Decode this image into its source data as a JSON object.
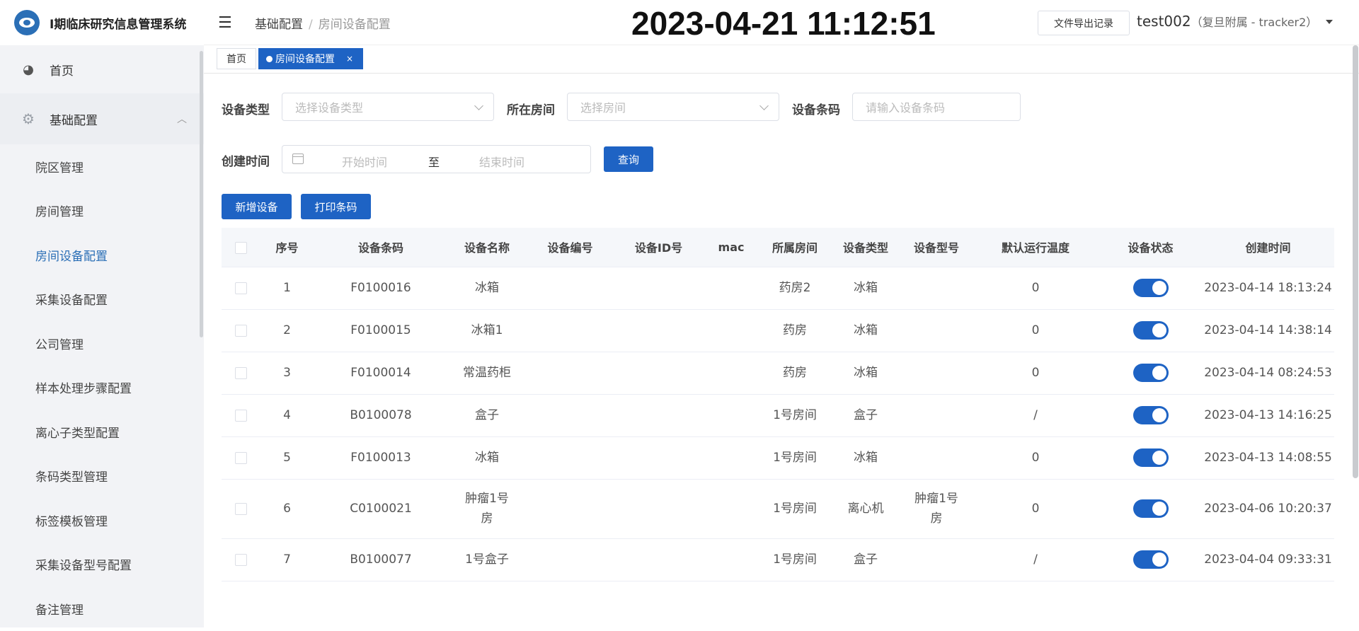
{
  "app": {
    "title": "I期临床研究信息管理系统"
  },
  "sidebar": {
    "home_label": "首页",
    "group_label": "基础配置",
    "items": [
      {
        "label": "院区管理"
      },
      {
        "label": "房间管理"
      },
      {
        "label": "房间设备配置",
        "active": true
      },
      {
        "label": "采集设备配置"
      },
      {
        "label": "公司管理"
      },
      {
        "label": "样本处理步骤配置"
      },
      {
        "label": "离心子类型配置"
      },
      {
        "label": "条码类型管理"
      },
      {
        "label": "标签模板管理"
      },
      {
        "label": "采集设备型号配置"
      },
      {
        "label": "备注管理"
      }
    ]
  },
  "header": {
    "breadcrumb": [
      "基础配置",
      "房间设备配置"
    ],
    "breadcrumb_sep": "/",
    "clock": "2023-04-21 11:12:51",
    "export_label": "文件导出记录",
    "user_name": "test002",
    "user_org": "（复旦附属 - tracker2）"
  },
  "tabs": {
    "home": "首页",
    "current": "房间设备配置",
    "close": "×"
  },
  "filters": {
    "device_type_label": "设备类型",
    "device_type_placeholder": "选择设备类型",
    "room_label": "所在房间",
    "room_placeholder": "选择房间",
    "barcode_label": "设备条码",
    "barcode_placeholder": "请输入设备条码",
    "created_label": "创建时间",
    "start_placeholder": "开始时间",
    "range_sep": "至",
    "end_placeholder": "结束时间",
    "query_label": "查询"
  },
  "actions": {
    "add_label": "新增设备",
    "print_label": "打印条码"
  },
  "table": {
    "columns": [
      "序号",
      "设备条码",
      "设备名称",
      "设备编号",
      "设备ID号",
      "mac",
      "所属房间",
      "设备类型",
      "设备型号",
      "默认运行温度",
      "设备状态",
      "创建时间"
    ],
    "rows": [
      {
        "no": "1",
        "barcode": "F0100016",
        "name": "冰箱",
        "code": "",
        "devid": "",
        "mac": "",
        "room": "药房2",
        "type": "冰箱",
        "model": "",
        "temp": "0",
        "status_on": true,
        "created": "2023-04-14 18:13:24"
      },
      {
        "no": "2",
        "barcode": "F0100015",
        "name": "冰箱1",
        "code": "",
        "devid": "",
        "mac": "",
        "room": "药房",
        "type": "冰箱",
        "model": "",
        "temp": "0",
        "status_on": true,
        "created": "2023-04-14 14:38:14"
      },
      {
        "no": "3",
        "barcode": "F0100014",
        "name": "常温药柜",
        "code": "",
        "devid": "",
        "mac": "",
        "room": "药房",
        "type": "冰箱",
        "model": "",
        "temp": "0",
        "status_on": true,
        "created": "2023-04-14 08:24:53"
      },
      {
        "no": "4",
        "barcode": "B0100078",
        "name": "盒子",
        "code": "",
        "devid": "",
        "mac": "",
        "room": "1号房间",
        "type": "盒子",
        "model": "",
        "temp": "/",
        "status_on": true,
        "created": "2023-04-13 14:16:25"
      },
      {
        "no": "5",
        "barcode": "F0100013",
        "name": "冰箱",
        "code": "",
        "devid": "",
        "mac": "",
        "room": "1号房间",
        "type": "冰箱",
        "model": "",
        "temp": "0",
        "status_on": true,
        "created": "2023-04-13 14:08:55"
      },
      {
        "no": "6",
        "barcode": "C0100021",
        "name": "肿瘤1号房",
        "code": "",
        "devid": "",
        "mac": "",
        "room": "1号房间",
        "type": "离心机",
        "model": "肿瘤1号房",
        "temp": "0",
        "status_on": true,
        "created": "2023-04-06 10:20:37"
      },
      {
        "no": "7",
        "barcode": "B0100077",
        "name": "1号盒子",
        "code": "",
        "devid": "",
        "mac": "",
        "room": "1号房间",
        "type": "盒子",
        "model": "",
        "temp": "/",
        "status_on": true,
        "created": "2023-04-04 09:33:31"
      }
    ]
  }
}
